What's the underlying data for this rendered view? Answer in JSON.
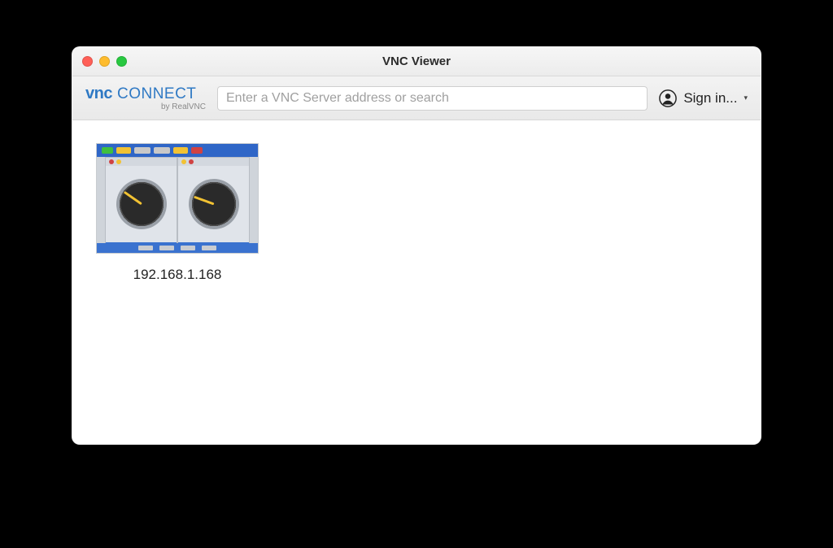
{
  "window": {
    "title": "VNC Viewer"
  },
  "brand": {
    "name_part1": "vnc",
    "name_part2": "connect",
    "subtitle": "by RealVNC"
  },
  "search": {
    "placeholder": "Enter a VNC Server address or search",
    "value": ""
  },
  "account": {
    "signin_label": "Sign in..."
  },
  "connections": [
    {
      "address": "192.168.1.168"
    }
  ]
}
